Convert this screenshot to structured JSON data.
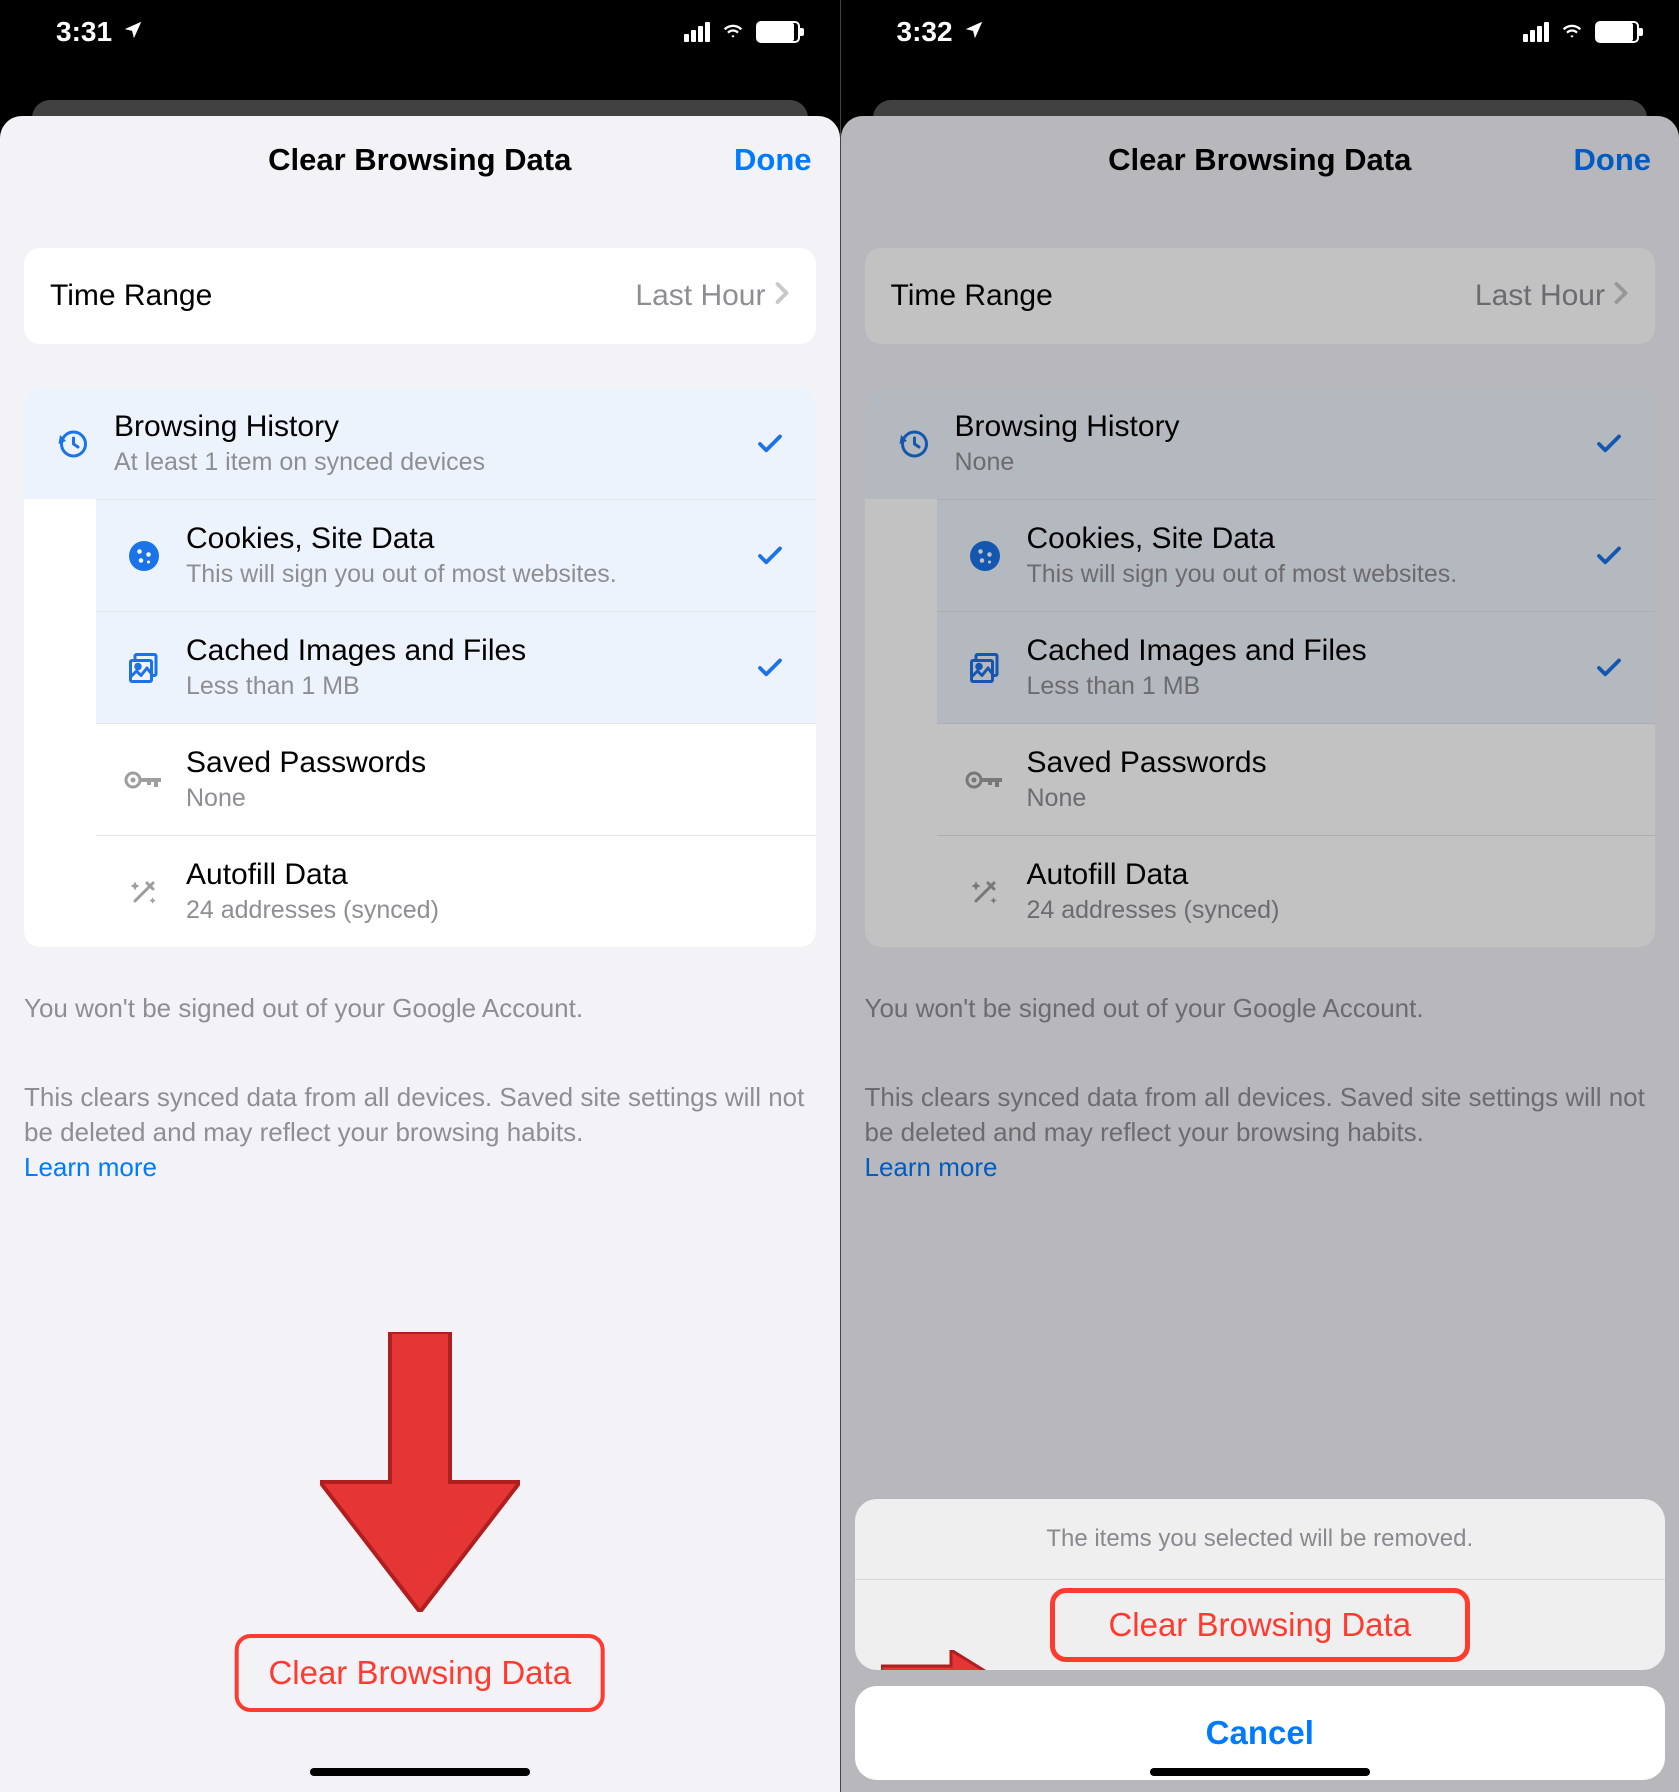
{
  "left": {
    "status_time": "3:31",
    "nav_title": "Clear Browsing Data",
    "nav_done": "Done",
    "time_range_label": "Time Range",
    "time_range_value": "Last Hour",
    "items": [
      {
        "title": "Browsing History",
        "sub": "At least 1 item on synced devices",
        "checked": true,
        "icon": "history"
      },
      {
        "title": "Cookies, Site Data",
        "sub": "This will sign you out of most websites.",
        "checked": true,
        "icon": "cookie"
      },
      {
        "title": "Cached Images and Files",
        "sub": "Less than 1 MB",
        "checked": true,
        "icon": "image"
      },
      {
        "title": "Saved Passwords",
        "sub": "None",
        "checked": false,
        "icon": "key"
      },
      {
        "title": "Autofill Data",
        "sub": "24 addresses (synced)",
        "checked": false,
        "icon": "wand"
      }
    ],
    "footnote1": "You won't be signed out of your Google Account.",
    "footnote2": "This clears synced data from all devices. Saved site settings will not be deleted and may reflect your browsing habits.",
    "learn_more": "Learn more",
    "clear_button": "Clear Browsing Data"
  },
  "right": {
    "status_time": "3:32",
    "nav_title": "Clear Browsing Data",
    "nav_done": "Done",
    "time_range_label": "Time Range",
    "time_range_value": "Last Hour",
    "items": [
      {
        "title": "Browsing History",
        "sub": "None",
        "checked": true,
        "icon": "history"
      },
      {
        "title": "Cookies, Site Data",
        "sub": "This will sign you out of most websites.",
        "checked": true,
        "icon": "cookie"
      },
      {
        "title": "Cached Images and Files",
        "sub": "Less than 1 MB",
        "checked": true,
        "icon": "image"
      },
      {
        "title": "Saved Passwords",
        "sub": "None",
        "checked": false,
        "icon": "key"
      },
      {
        "title": "Autofill Data",
        "sub": "24 addresses (synced)",
        "checked": false,
        "icon": "wand"
      }
    ],
    "footnote1": "You won't be signed out of your Google Account.",
    "footnote2": "This clears synced data from all devices. Saved site settings will not be deleted and may reflect your browsing habits.",
    "learn_more": "Learn more",
    "action_title": "The items you selected will be removed.",
    "action_confirm": "Clear Browsing Data",
    "action_cancel": "Cancel"
  }
}
